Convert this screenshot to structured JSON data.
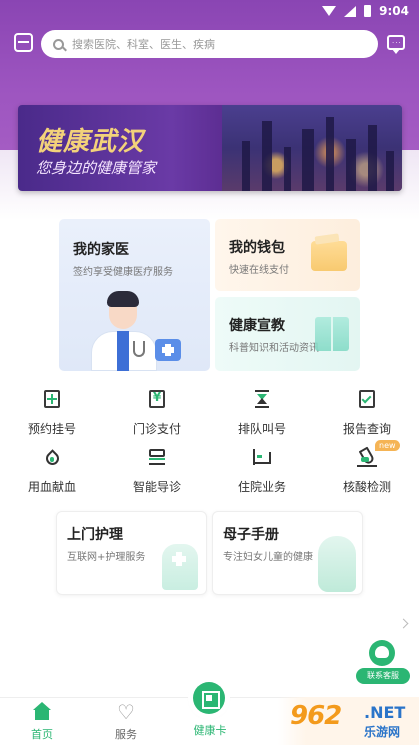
{
  "status_bar": {
    "time": "9:04"
  },
  "search": {
    "placeholder": "搜索医院、科室、医生、疾病"
  },
  "banner": {
    "title": "健康武汉",
    "subtitle": "您身边的健康管家"
  },
  "cards": {
    "family": {
      "title": "我的家医",
      "subtitle": "签约享受健康医疗服务"
    },
    "wallet": {
      "title": "我的钱包",
      "subtitle": "快速在线支付"
    },
    "education": {
      "title": "健康宣教",
      "subtitle": "科普知识和活动资讯"
    }
  },
  "services": [
    {
      "label": "预约挂号",
      "icon": "register-icon"
    },
    {
      "label": "门诊支付",
      "icon": "yen-payment-icon"
    },
    {
      "label": "排队叫号",
      "icon": "hourglass-icon"
    },
    {
      "label": "报告查询",
      "icon": "report-check-icon"
    },
    {
      "label": "用血献血",
      "icon": "blood-drop-icon"
    },
    {
      "label": "智能导诊",
      "icon": "layers-icon"
    },
    {
      "label": "住院业务",
      "icon": "bed-icon"
    },
    {
      "label": "核酸检测",
      "icon": "flask-icon",
      "badge": "new"
    }
  ],
  "features": {
    "home_care": {
      "title": "上门护理",
      "subtitle": "互联网+护理服务"
    },
    "mother_child": {
      "title": "母子手册",
      "subtitle": "专注妇女儿童的健康"
    }
  },
  "customer_service": {
    "label": "联系客服"
  },
  "nav": {
    "home": "首页",
    "service": "服务",
    "card": "健康卡"
  },
  "watermark": {
    "logo": "962",
    "net": ".NET",
    "sub": "乐游网"
  },
  "colors": {
    "header": "#8a45b3",
    "accent": "#2bb673"
  }
}
